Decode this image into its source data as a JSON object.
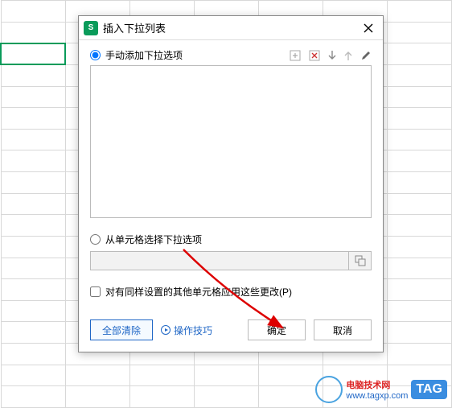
{
  "dialog": {
    "title": "插入下拉列表",
    "option_manual": "手动添加下拉选项",
    "option_fromcells": "从单元格选择下拉选项",
    "checkbox_apply": "对有同样设置的其他单元格应用这些更改(P)",
    "btn_clearall": "全部清除",
    "btn_tips": "操作技巧",
    "btn_ok": "确定",
    "btn_cancel": "取消",
    "cellref_value": ""
  },
  "icons": {
    "add": "add-item-icon",
    "delete": "delete-item-icon",
    "down": "move-down-icon",
    "up": "move-up-icon",
    "edit": "edit-icon",
    "picker": "range-picker-icon"
  },
  "watermark": {
    "line1": "电脑技术网",
    "line2": "www.tagxp.com",
    "tag": "TAG"
  }
}
